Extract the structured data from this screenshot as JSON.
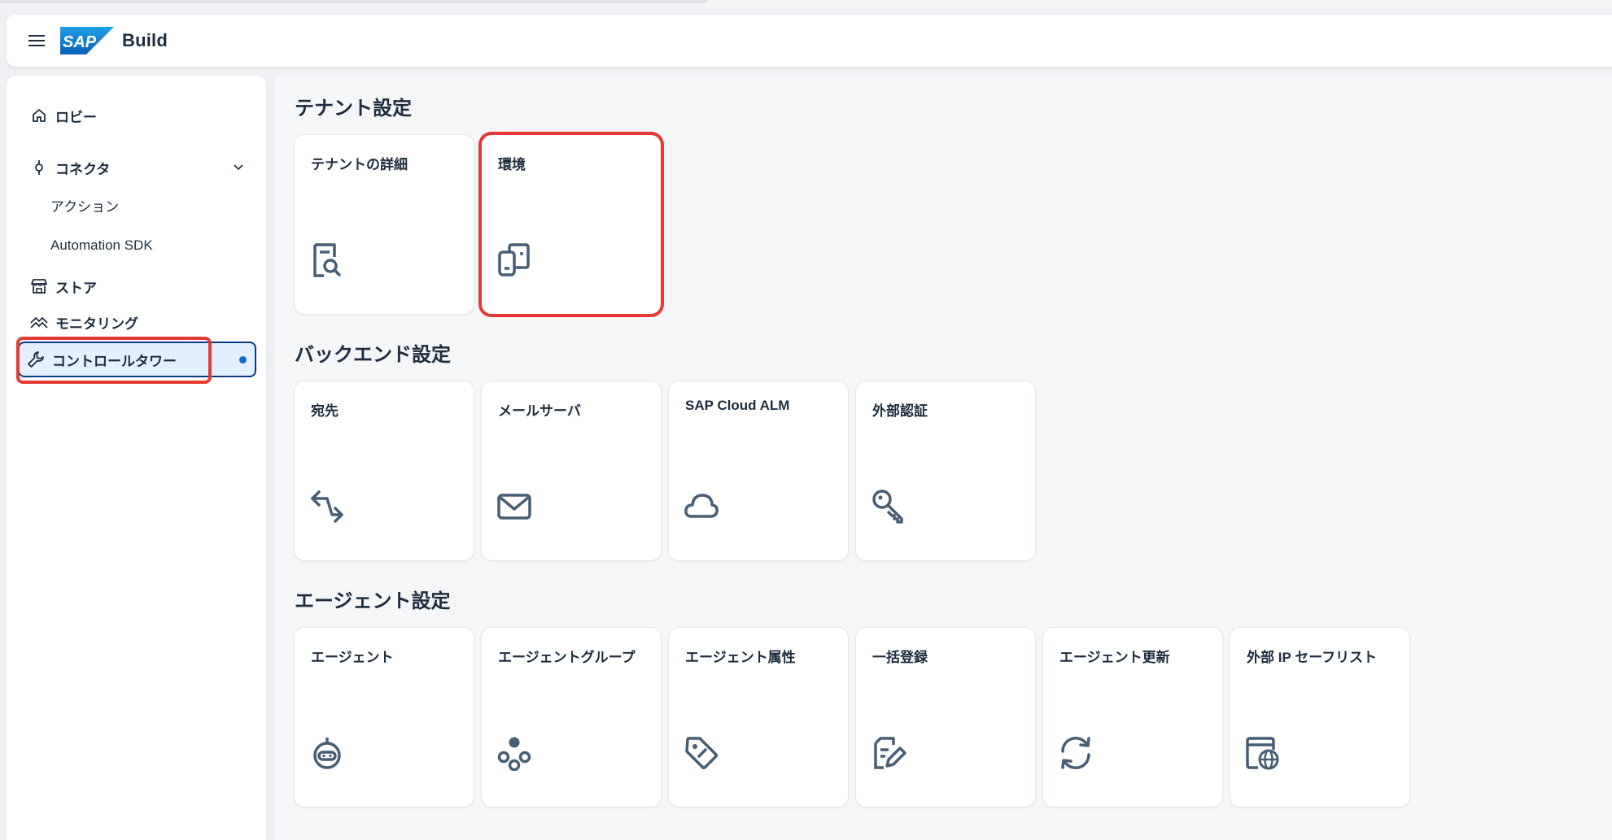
{
  "app": {
    "product_name": "Build",
    "logo_text": "SAP"
  },
  "sidebar": {
    "items": [
      {
        "label": "ロビー",
        "icon": "home-icon"
      },
      {
        "label": "コネクタ",
        "icon": "connector-icon",
        "expanded": true
      },
      {
        "label": "アクション"
      },
      {
        "label": "Automation SDK"
      },
      {
        "label": "ストア",
        "icon": "store-icon"
      },
      {
        "label": "モニタリング",
        "icon": "monitoring-icon"
      },
      {
        "label": "コントロールタワー",
        "icon": "wrench-icon",
        "active": true
      }
    ]
  },
  "sections": [
    {
      "title": "テナント設定",
      "cards": [
        {
          "title": "テナントの詳細",
          "icon": "document-search-icon"
        },
        {
          "title": "環境",
          "icon": "environment-icon",
          "highlighted": true
        }
      ]
    },
    {
      "title": "バックエンド設定",
      "cards": [
        {
          "title": "宛先",
          "icon": "arrows-exchange-icon"
        },
        {
          "title": "メールサーバ",
          "icon": "mail-icon"
        },
        {
          "title": "SAP Cloud ALM",
          "icon": "cloud-icon"
        },
        {
          "title": "外部認証",
          "icon": "key-icon"
        }
      ]
    },
    {
      "title": "エージェント設定",
      "cards": [
        {
          "title": "エージェント",
          "icon": "robot-icon"
        },
        {
          "title": "エージェントグループ",
          "icon": "group-icon"
        },
        {
          "title": "エージェント属性",
          "icon": "tag-icon"
        },
        {
          "title": "一括登録",
          "icon": "bulk-edit-icon"
        },
        {
          "title": "エージェント更新",
          "icon": "refresh-icon"
        },
        {
          "title": "外部 IP セーフリスト",
          "icon": "web-safelist-icon"
        }
      ]
    }
  ],
  "colors": {
    "accent": "#0a6ed1",
    "active_border": "#0a3a84",
    "active_bg": "#e3f0ff",
    "highlight": "#e53935",
    "icon": "#475e75"
  }
}
